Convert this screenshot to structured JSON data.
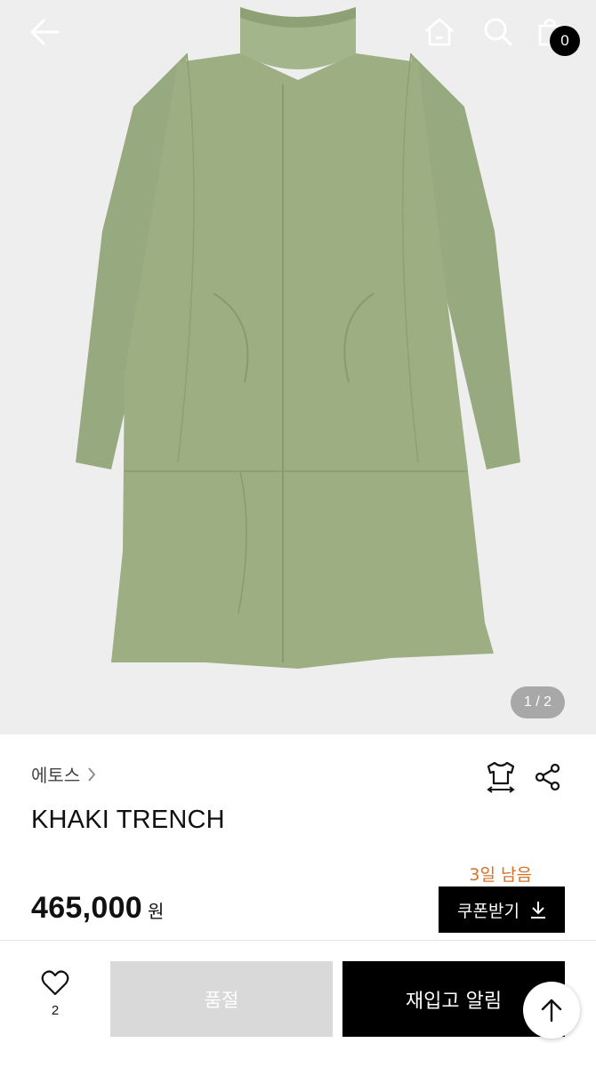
{
  "header": {
    "back_icon": "arrow-left-icon",
    "home_icon": "home-icon",
    "search_icon": "search-icon",
    "cart_icon": "shopping-bag-icon",
    "cart_count": "0"
  },
  "gallery": {
    "pager": "1 / 2",
    "garment_color": "#9cae82"
  },
  "product": {
    "brand": "에토스",
    "name": "KHAKI TRENCH",
    "stock_notice": "3일 남음",
    "price": "465,000",
    "currency": "원",
    "coupon_label": "쿠폰받기",
    "size_icon": "size-guide-icon",
    "share_icon": "share-icon"
  },
  "actions": {
    "like_count": "2",
    "soldout_label": "품절",
    "restock_label": "재입고 알림"
  },
  "colors": {
    "accent_orange": "#d6712a",
    "primary_black": "#000000",
    "disabled_gray": "#d9d9d9"
  }
}
